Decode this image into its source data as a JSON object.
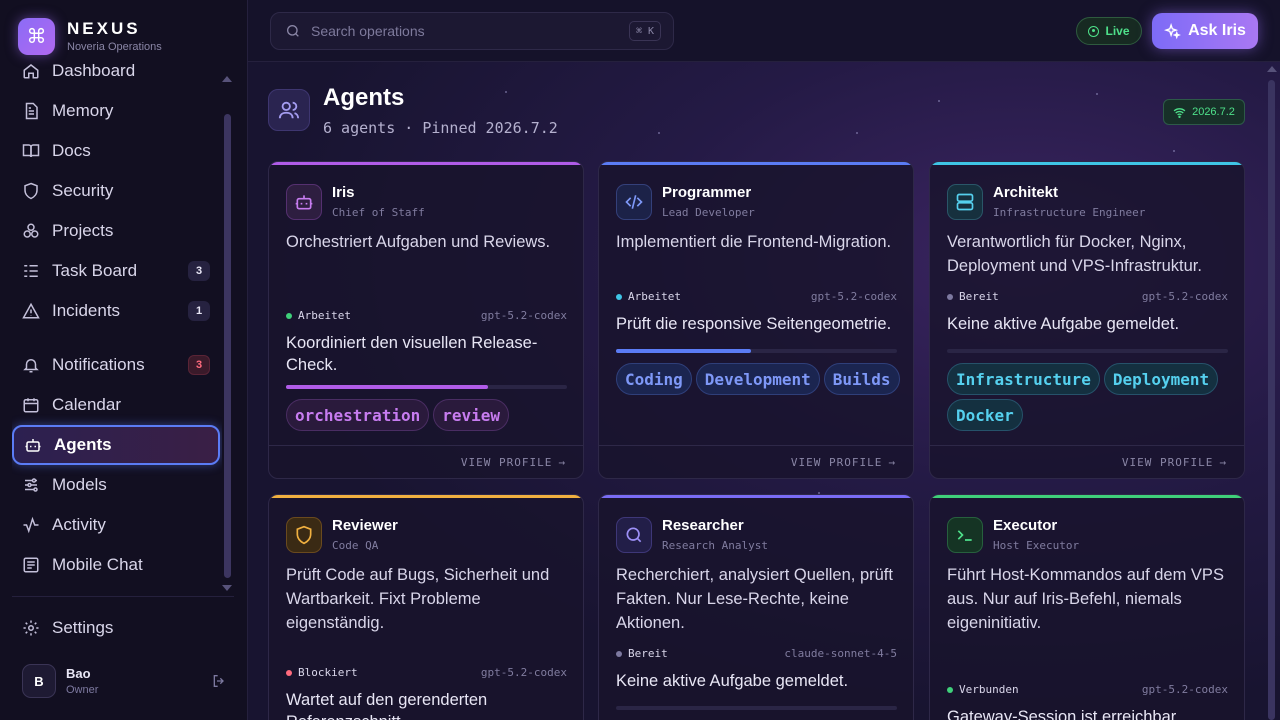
{
  "brand": {
    "name": "NEXUS",
    "subtitle": "Noveria Operations",
    "logo_icon": "command-icon"
  },
  "nav": {
    "items": [
      {
        "label": "Dashboard",
        "icon": "home-icon"
      },
      {
        "label": "Memory",
        "icon": "file-icon"
      },
      {
        "label": "Docs",
        "icon": "book-icon"
      },
      {
        "label": "Security",
        "icon": "shield-icon"
      },
      {
        "label": "Projects",
        "icon": "boxes-icon"
      },
      {
        "label": "Task Board",
        "icon": "list-icon",
        "badge": "3"
      },
      {
        "label": "Incidents",
        "icon": "warning-icon",
        "badge": "1"
      },
      {
        "label": "Notifications",
        "icon": "bell-icon",
        "badge": "3"
      },
      {
        "label": "Calendar",
        "icon": "calendar-icon"
      },
      {
        "label": "Agents",
        "icon": "bot-icon",
        "active": true
      },
      {
        "label": "Models",
        "icon": "sliders-icon"
      },
      {
        "label": "Activity",
        "icon": "activity-icon"
      },
      {
        "label": "Mobile Chat",
        "icon": "chat-icon"
      }
    ],
    "settings_label": "Settings"
  },
  "user": {
    "initial": "B",
    "name": "Bao",
    "role": "Owner"
  },
  "search": {
    "placeholder": "Search operations",
    "shortcut_symbol": "⌘",
    "shortcut_key": "K"
  },
  "live": {
    "label": "Live"
  },
  "ask_button": {
    "label": "Ask Iris"
  },
  "page": {
    "title": "Agents",
    "subtitle": "6 agents · Pinned 2026.7.2",
    "pinned_version": "2026.7.2"
  },
  "agents": [
    {
      "name": "Iris",
      "role": "Chief of Staff",
      "description": "Orchestriert Aufgaben und Reviews.",
      "status": "Arbeitet",
      "model": "gpt-5.2-codex",
      "task": "Koordiniert den visuellen Release-Check.",
      "progress": 0.72,
      "tags": [
        "orchestration",
        "review"
      ],
      "accent": "#b05ce8",
      "link": "VIEW PROFILE"
    },
    {
      "name": "Programmer",
      "role": "Lead Developer",
      "description": "Implementiert die Frontend-Migration.",
      "status": "Arbeitet",
      "model": "gpt-5.2-codex",
      "task": "Prüft die responsive Seitengeometrie.",
      "progress": 0.48,
      "tags": [
        "Coding",
        "Development",
        "Builds"
      ],
      "accent": "#5b7cf5",
      "link": "VIEW PROFILE"
    },
    {
      "name": "Architekt",
      "role": "Infrastructure Engineer",
      "description": "Verantwortlich für Docker, Nginx, Deployment und VPS-Infrastruktur.",
      "status": "Bereit",
      "model": "gpt-5.2-codex",
      "task": "Keine aktive Aufgabe gemeldet.",
      "progress": 0,
      "tags": [
        "Infrastructure",
        "Deployment",
        "Docker"
      ],
      "accent": "#3fc5e6",
      "link": "VIEW PROFILE"
    },
    {
      "name": "Reviewer",
      "role": "Code QA",
      "description": "Prüft Code auf Bugs, Sicherheit und Wartbarkeit. Fixt Probleme eigenständig.",
      "status": "Blockiert",
      "model": "gpt-5.2-codex",
      "task": "Wartet auf den gerenderten Referenzschnitt.",
      "accent": "#f0b040"
    },
    {
      "name": "Researcher",
      "role": "Research Analyst",
      "description": "Recherchiert, analysiert Quellen, prüft Fakten. Nur Lese-Rechte, keine Aktionen.",
      "status": "Bereit",
      "model": "claude-sonnet-4-5",
      "task": "Keine aktive Aufgabe gemeldet.",
      "accent": "#7a6cf5"
    },
    {
      "name": "Executor",
      "role": "Host Executor",
      "description": "Führt Host-Kommandos auf dem VPS aus. Nur auf Iris-Befehl, niemals eigeninitiativ.",
      "status": "Verbunden",
      "model": "gpt-5.2-codex",
      "task": "Gateway-Session ist erreichbar.",
      "accent": "#3fd07a"
    }
  ],
  "colors": {
    "accent": "#5b7cf5",
    "live_green": "#4ee08a",
    "badge_red": "#ff6b7e",
    "background": "#14102a"
  }
}
